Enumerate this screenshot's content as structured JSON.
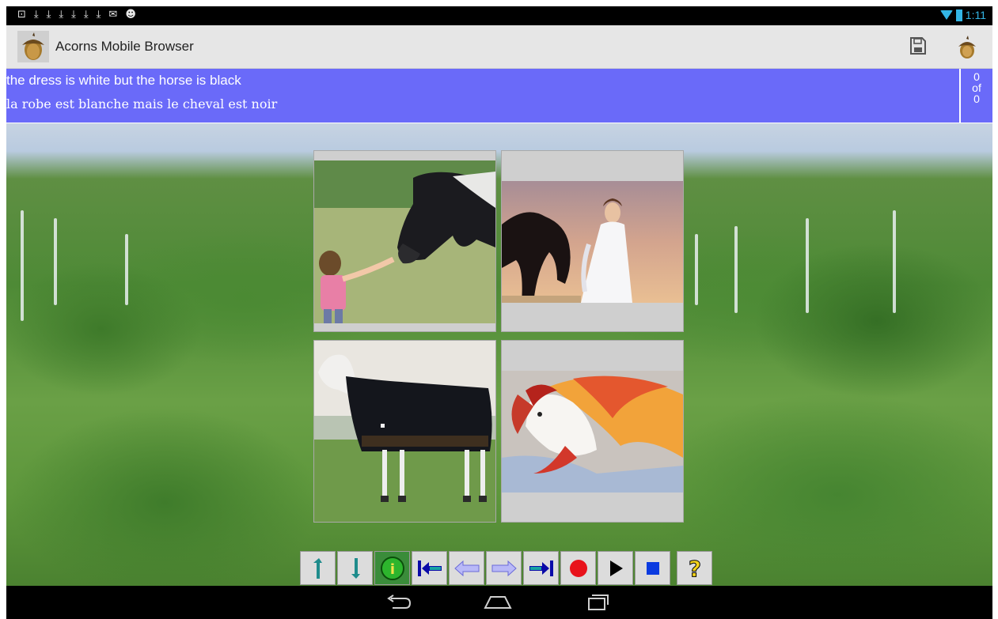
{
  "status_bar": {
    "notification_icons": [
      "download-icon",
      "download-icon",
      "download-icon",
      "download-icon",
      "download-icon",
      "download-icon",
      "download-icon",
      "mail-icon",
      "cat-icon"
    ],
    "clock": "1:11"
  },
  "action_bar": {
    "title": "Acorns Mobile Browser",
    "icons": [
      "acorn-logo-icon",
      "save-icon",
      "acorn-icon"
    ]
  },
  "banner": {
    "native_sentence": "the dress is white but the horse is black",
    "target_sentence": "la robe est blanche mais le cheval est noir",
    "counter": {
      "current": "0",
      "of_label": "of",
      "total": "0"
    },
    "color": "#6a6af9"
  },
  "pictures": [
    {
      "name": "girl-feeding-horse"
    },
    {
      "name": "woman-in-white-dress-with-black-horse"
    },
    {
      "name": "horse-in-blanket"
    },
    {
      "name": "red-white-horse-painting"
    }
  ],
  "toolbar": {
    "buttons": [
      "swap-left-icon",
      "swap-right-icon",
      "info-icon",
      "first-icon",
      "previous-icon",
      "next-icon",
      "last-icon",
      "record-icon",
      "play-icon",
      "stop-icon",
      "help-icon"
    ]
  },
  "navigation_bar": {
    "buttons": [
      "back-icon",
      "home-icon",
      "recent-apps-icon"
    ]
  }
}
